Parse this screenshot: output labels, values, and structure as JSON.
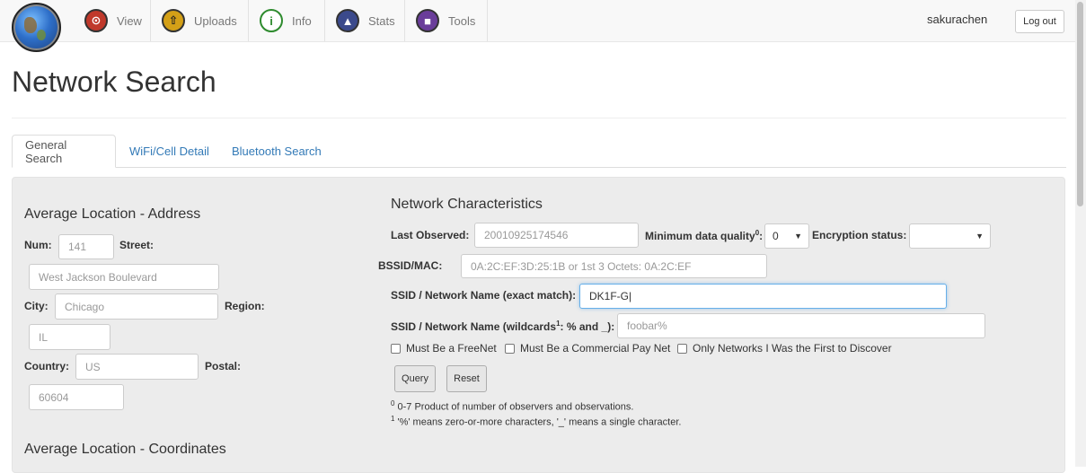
{
  "nav": {
    "items": [
      {
        "label": "View",
        "icon": "view-icon",
        "color": "#c0392b"
      },
      {
        "label": "Uploads",
        "icon": "upload-icon",
        "color": "#d4a017"
      },
      {
        "label": "Info",
        "icon": "info-icon",
        "color": "#2e8b2e"
      },
      {
        "label": "Stats",
        "icon": "stats-icon",
        "color": "#3b4a8c"
      },
      {
        "label": "Tools",
        "icon": "tools-icon",
        "color": "#6a3d9a"
      }
    ],
    "username": "sakurachen",
    "logout_label": "Log out"
  },
  "page_title": "Network Search",
  "tabs": [
    {
      "label": "General Search",
      "active": true
    },
    {
      "label": "WiFi/Cell Detail",
      "active": false
    },
    {
      "label": "Bluetooth Search",
      "active": false
    }
  ],
  "address": {
    "heading": "Average Location - Address",
    "num_label": "Num:",
    "num_placeholder": "141",
    "street_label": "Street:",
    "street_placeholder": "West Jackson Boulevard",
    "city_label": "City:",
    "city_placeholder": "Chicago",
    "region_label": "Region:",
    "region_placeholder": "IL",
    "country_label": "Country:",
    "country_placeholder": "US",
    "postal_label": "Postal:",
    "postal_placeholder": "60604"
  },
  "coords": {
    "heading": "Average Location - Coordinates"
  },
  "network": {
    "heading": "Network Characteristics",
    "last_observed_label": "Last Observed:",
    "last_observed_placeholder": "20010925174546",
    "min_quality_label": "Minimum data quality",
    "min_quality_sup": "0",
    "min_quality_colon": ":",
    "min_quality_value": "0",
    "encryption_label": "Encryption status:",
    "encryption_value": "",
    "bssid_label": "BSSID/MAC:",
    "bssid_placeholder": "0A:2C:EF:3D:25:1B or 1st 3 Octets: 0A:2C:EF",
    "ssid_exact_label": "SSID / Network Name (exact match):",
    "ssid_exact_value": "DK1F-G|",
    "ssid_wild_label_pre": "SSID / Network Name (wildcards",
    "ssid_wild_sup": "1",
    "ssid_wild_label_post": ": % and _):",
    "ssid_wild_placeholder": "foobar%",
    "chk_freenet": "Must Be a FreeNet",
    "chk_paynet": "Must Be a Commercial Pay Net",
    "chk_first": "Only Networks I Was the First to Discover",
    "query_label": "Query",
    "reset_label": "Reset",
    "note0_sup": "0",
    "note0": " 0-7 Product of number of observers and observations.",
    "note1_sup": "1",
    "note1": " '%' means zero-or-more characters, '_' means a single character."
  }
}
